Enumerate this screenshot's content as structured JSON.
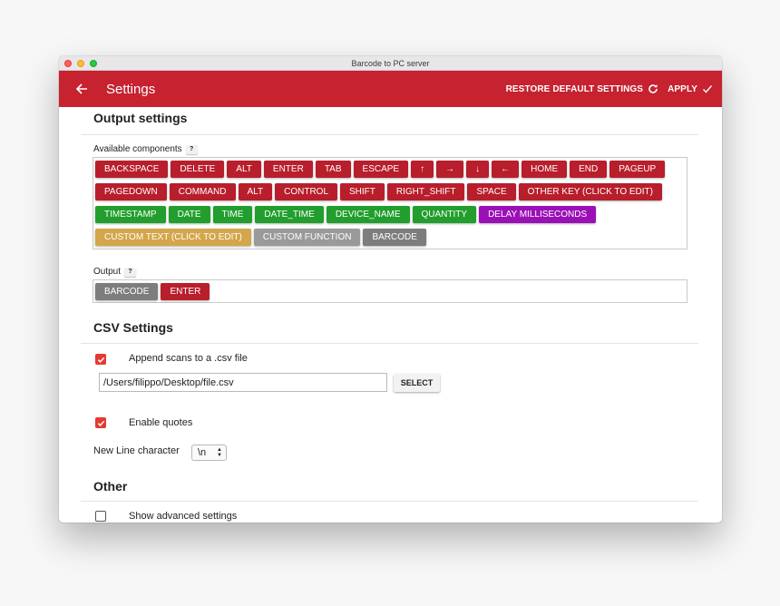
{
  "window": {
    "title": "Barcode to PC server"
  },
  "appbar": {
    "title": "Settings",
    "restore_label": "RESTORE DEFAULT SETTINGS",
    "apply_label": "APPLY",
    "color": "#c62230"
  },
  "output_settings": {
    "title": "Output settings",
    "available_label": "Available components",
    "help_label": "?",
    "available_rows": [
      [
        {
          "label": "BACKSPACE",
          "color": "red"
        },
        {
          "label": "DELETE",
          "color": "red"
        },
        {
          "label": "ALT",
          "color": "red"
        },
        {
          "label": "ENTER",
          "color": "red"
        },
        {
          "label": "TAB",
          "color": "red"
        },
        {
          "label": "ESCAPE",
          "color": "red"
        },
        {
          "label": "↑",
          "color": "red"
        },
        {
          "label": "→",
          "color": "red"
        },
        {
          "label": "↓",
          "color": "red"
        },
        {
          "label": "←",
          "color": "red"
        },
        {
          "label": "HOME",
          "color": "red"
        },
        {
          "label": "END",
          "color": "red"
        },
        {
          "label": "PAGEUP",
          "color": "red"
        }
      ],
      [
        {
          "label": "PAGEDOWN",
          "color": "red"
        },
        {
          "label": "COMMAND",
          "color": "red"
        },
        {
          "label": "ALT",
          "color": "red"
        },
        {
          "label": "CONTROL",
          "color": "red"
        },
        {
          "label": "SHIFT",
          "color": "red"
        },
        {
          "label": "RIGHT_SHIFT",
          "color": "red"
        },
        {
          "label": "SPACE",
          "color": "red"
        },
        {
          "label": "OTHER KEY (CLICK TO EDIT)",
          "color": "red"
        }
      ],
      [
        {
          "label": "TIMESTAMP",
          "color": "green"
        },
        {
          "label": "DATE",
          "color": "green"
        },
        {
          "label": "TIME",
          "color": "green"
        },
        {
          "label": "DATE_TIME",
          "color": "green"
        },
        {
          "label": "DEVICE_NAME",
          "color": "green"
        },
        {
          "label": "QUANTITY",
          "color": "green"
        },
        {
          "label": "DELAY MILLISECONDS",
          "color": "purple"
        }
      ],
      [
        {
          "label": "CUSTOM TEXT (CLICK TO EDIT)",
          "color": "gold"
        },
        {
          "label": "CUSTOM FUNCTION",
          "color": "grey"
        },
        {
          "label": "BARCODE",
          "color": "darkgrey"
        }
      ]
    ],
    "output_label": "Output",
    "output_items": [
      {
        "label": "BARCODE",
        "color": "darkgrey"
      },
      {
        "label": "ENTER",
        "color": "red"
      }
    ]
  },
  "csv_settings": {
    "title": "CSV Settings",
    "append_label": "Append scans to a .csv file",
    "append_checked": true,
    "path_value": "/Users/filippo/Desktop/file.csv",
    "select_label": "SELECT",
    "quotes_label": "Enable quotes",
    "quotes_checked": true,
    "newline_label": "New Line character",
    "newline_value": "\\n"
  },
  "other": {
    "title": "Other",
    "advanced_label": "Show advanced settings",
    "advanced_checked": false
  },
  "colors": {
    "red": "#b81e2b",
    "green": "#229e2e",
    "purple": "#9b10b6",
    "gold": "#d3a64b",
    "grey": "#9a9a9a",
    "darkgrey": "#7d7d7d",
    "checkbox": "#e53935"
  }
}
